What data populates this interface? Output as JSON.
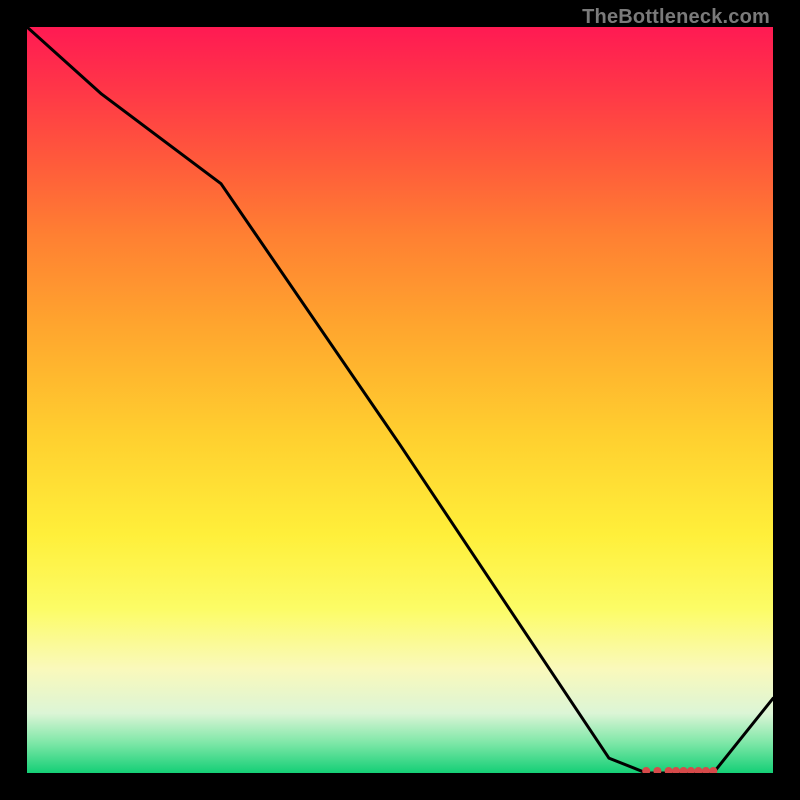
{
  "watermark": "TheBottleneck.com",
  "chart_data": {
    "type": "line",
    "title": "",
    "xlabel": "",
    "ylabel": "",
    "xlim": [
      0,
      100
    ],
    "ylim": [
      0,
      100
    ],
    "series": [
      {
        "name": "curve",
        "x": [
          0,
          10,
          26,
          50,
          70,
          78,
          83,
          86,
          88,
          92,
          100
        ],
        "y": [
          100,
          91,
          79,
          44,
          14,
          2,
          0,
          0,
          0,
          0,
          10
        ]
      }
    ],
    "flat_markers": {
      "x": [
        83,
        84.5,
        86,
        87,
        88,
        89,
        90,
        91,
        92
      ],
      "y": [
        0,
        0,
        0,
        0,
        0,
        0,
        0,
        0,
        0
      ]
    },
    "gradient_stops": [
      {
        "pos": 0,
        "color": "#ff1a53"
      },
      {
        "pos": 8,
        "color": "#ff3548"
      },
      {
        "pos": 18,
        "color": "#ff5a3b"
      },
      {
        "pos": 28,
        "color": "#ff8032"
      },
      {
        "pos": 40,
        "color": "#ffa52e"
      },
      {
        "pos": 55,
        "color": "#ffd02f"
      },
      {
        "pos": 68,
        "color": "#ffef3a"
      },
      {
        "pos": 78,
        "color": "#fcfc66"
      },
      {
        "pos": 86,
        "color": "#faf9bb"
      },
      {
        "pos": 92,
        "color": "#dcf5d6"
      },
      {
        "pos": 96,
        "color": "#7de7a7"
      },
      {
        "pos": 100,
        "color": "#14cf76"
      }
    ]
  }
}
